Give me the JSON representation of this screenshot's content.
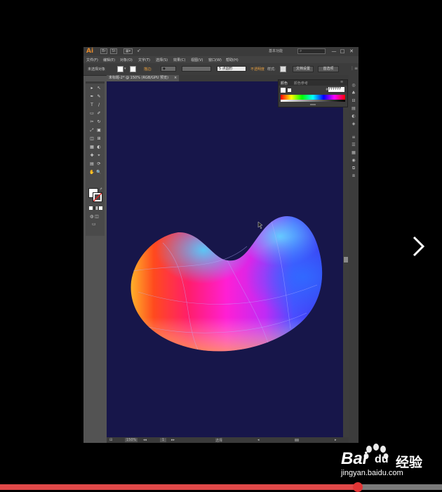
{
  "app": {
    "logo": "Ai",
    "workspace": "基本功能",
    "search_placeholder": "",
    "window_controls": [
      "—",
      "□",
      "✕"
    ]
  },
  "menu": {
    "items": [
      "文件(F)",
      "编辑(E)",
      "对象(O)",
      "文字(T)",
      "选择(S)",
      "效果(C)",
      "视图(V)",
      "窗口(W)",
      "帮助(H)"
    ]
  },
  "control_bar": {
    "selection": "未选择对象",
    "stroke_label": "描边:",
    "style_preset": "5 点圆形",
    "opacity_label": "不透明度",
    "style_label": "样式:",
    "doc_setup_button": "文档设置",
    "prefs_button": "首选项"
  },
  "document": {
    "tab_title": "未标题-2* @ 150% (RGB/GPU 预览)",
    "tab_close": "×"
  },
  "color_panel": {
    "tabs": [
      "颜色",
      "颜色参考"
    ],
    "hex_value": "FFFFFF"
  },
  "status": {
    "zoom": "150%",
    "page": "1",
    "tool": "选择"
  },
  "tools": [
    "▸",
    "↖",
    "✒",
    "✎",
    "T",
    "/",
    "▭",
    "✐",
    "✂",
    "↻",
    "⤢",
    "▣",
    "◫",
    "⊞",
    "▦",
    "◐",
    "✚",
    "⌖",
    "▤",
    "⟳",
    "✋",
    "🔍"
  ],
  "dock_icons": [
    "◎",
    "♣",
    "⊟",
    "▤",
    "◐",
    "◈",
    "≡",
    "☰",
    "▦",
    "◉",
    "⧉",
    "⧈"
  ],
  "video": {
    "next_icon": "chevron-right-icon",
    "progress": 0.81
  },
  "watermark": {
    "line1": "Bai",
    "line2": "经验",
    "url": "jingyan.baidu.com"
  },
  "colors": {
    "artboard_bg": "#17164a",
    "ui_dark": "#3c3c3c",
    "progress_red": "#e04848"
  }
}
